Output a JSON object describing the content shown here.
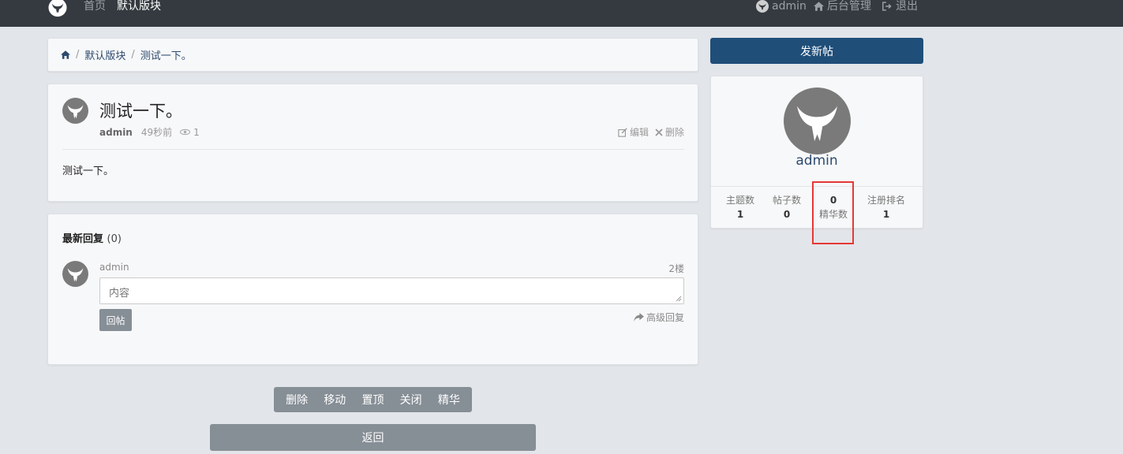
{
  "nav": {
    "home": "首页",
    "section": "默认版块",
    "user": "admin",
    "admin_panel": "后台管理",
    "logout": "退出"
  },
  "breadcrumb": {
    "section": "默认版块",
    "thread": "测试一下。"
  },
  "thread": {
    "title": "测试一下。",
    "author": "admin",
    "time": "49秒前",
    "views": "1",
    "edit": "编辑",
    "delete": "删除",
    "body": "测试一下。"
  },
  "replies": {
    "title": "最新回复",
    "count": "(0)",
    "author": "admin",
    "floor": "2楼",
    "placeholder": "内容",
    "submit": "回帖",
    "advanced": "高级回复"
  },
  "moderation": {
    "items": [
      "删除",
      "移动",
      "置顶",
      "关闭",
      "精华"
    ]
  },
  "back_label": "返回",
  "sidebar": {
    "new_post": "发新帖",
    "username": "admin",
    "stats": [
      {
        "label": "主题数",
        "value": "1"
      },
      {
        "label": "帖子数",
        "value": "0"
      },
      {
        "label": "精华数",
        "value": "0"
      },
      {
        "label": "注册排名",
        "value": "1"
      }
    ]
  },
  "colors": {
    "navbar": "#343a40",
    "accent": "#1f4e79",
    "button_gray": "#868e96",
    "highlight": "#e53935"
  },
  "icons": [
    "logo-icon",
    "home-icon",
    "eye-icon",
    "edit-icon",
    "close-icon",
    "share-icon",
    "logout-icon"
  ]
}
